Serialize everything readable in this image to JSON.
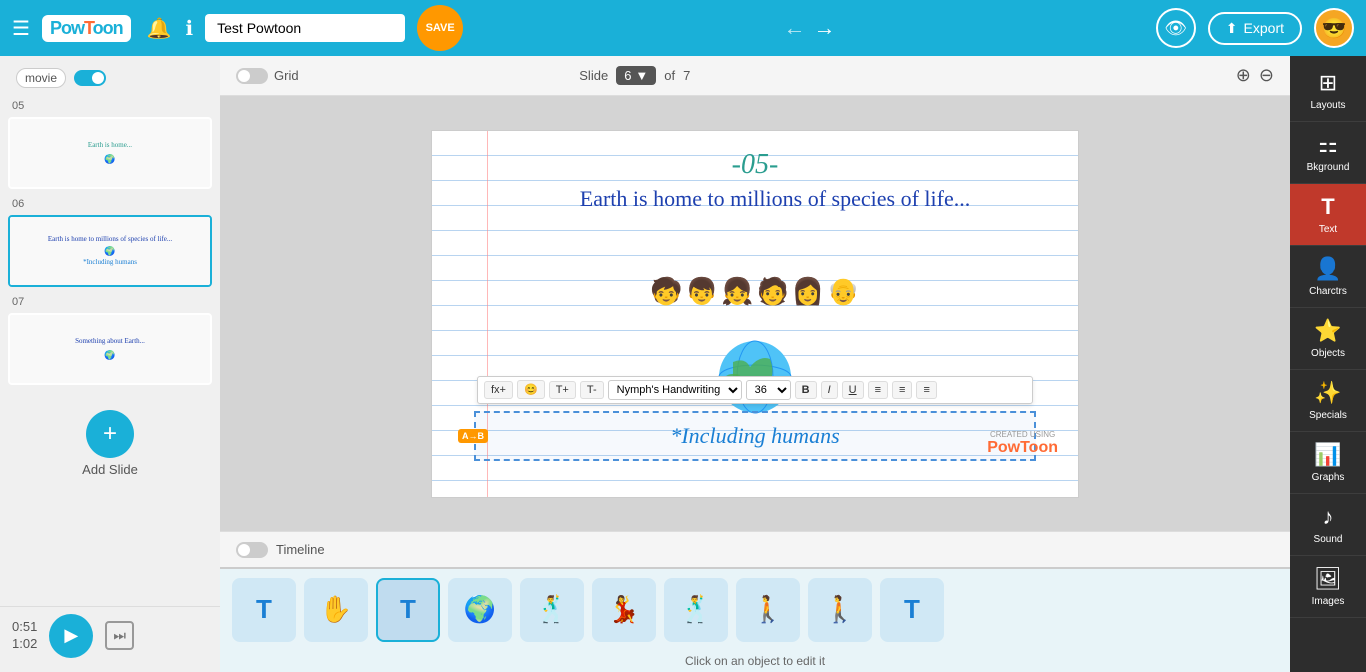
{
  "header": {
    "menu_icon": "☰",
    "logo_text": "Pow",
    "logo_accent": "Toon",
    "project_title": "Test Powtoon",
    "save_label": "SAVE",
    "nav_back": "◀",
    "nav_forward": "▶",
    "preview_icon": "👁",
    "export_label": "Export",
    "export_icon": "↑"
  },
  "slides_panel": {
    "movie_label": "movie",
    "slides": [
      {
        "number": "05",
        "thumb_text": "Earth is home..."
      },
      {
        "number": "06",
        "thumb_text": "Earth is home to millions of species of life...\n*Including humans",
        "active": true
      },
      {
        "number": "07",
        "thumb_text": "Something about Earth..."
      }
    ],
    "add_slide_label": "Add Slide"
  },
  "playback": {
    "current_time": "0:51",
    "total_time": "1:02",
    "play_icon": "▶",
    "skip_icon": "⏭"
  },
  "canvas_header": {
    "grid_label": "Grid",
    "slide_label": "Slide",
    "slide_number": "6",
    "of_label": "of",
    "total_slides": "7",
    "zoom_in": "⊕",
    "zoom_out": "⊖"
  },
  "slide": {
    "number_text": "-05-",
    "headline": "Earth is home to millions of species of life...",
    "selected_text": "*Including humans",
    "watermark_top": "CREATED USING",
    "watermark_logo": "PowToon"
  },
  "text_toolbar": {
    "fx_btn": "fx+",
    "face_btn": "😊",
    "text_plus": "T+",
    "text_minus": "T-",
    "font_name": "Nymph's Handwriting",
    "font_size": "36",
    "bold": "B",
    "italic": "I",
    "underline": "U",
    "align_left": "≡",
    "align_center": "≡",
    "align_right": "≡"
  },
  "timeline": {
    "label": "Timeline"
  },
  "objects_bar": {
    "hint": "Click on an object to edit it",
    "items": [
      {
        "icon": "T",
        "label": "text1"
      },
      {
        "icon": "✋",
        "label": "hand"
      },
      {
        "icon": "T",
        "label": "text2",
        "selected": true
      },
      {
        "icon": "🌍",
        "label": "globe"
      },
      {
        "icon": "🕺",
        "label": "char1"
      },
      {
        "icon": "💃",
        "label": "char2"
      },
      {
        "icon": "🕺",
        "label": "char3"
      },
      {
        "icon": "🚶",
        "label": "char4"
      },
      {
        "icon": "🚶",
        "label": "char5"
      },
      {
        "icon": "T",
        "label": "text3"
      }
    ]
  },
  "right_sidebar": {
    "items": [
      {
        "icon": "⊞",
        "label": "Layouts"
      },
      {
        "icon": "⚏",
        "label": "Bkground"
      },
      {
        "icon": "T",
        "label": "Text",
        "active": true
      },
      {
        "icon": "👤",
        "label": "Charctrs"
      },
      {
        "icon": "⭐",
        "label": "Objects"
      },
      {
        "icon": "✨",
        "label": "Specials"
      },
      {
        "icon": "📊",
        "label": "Graphs"
      },
      {
        "icon": "♪",
        "label": "Sound"
      },
      {
        "icon": "🖼",
        "label": "Images"
      }
    ]
  }
}
